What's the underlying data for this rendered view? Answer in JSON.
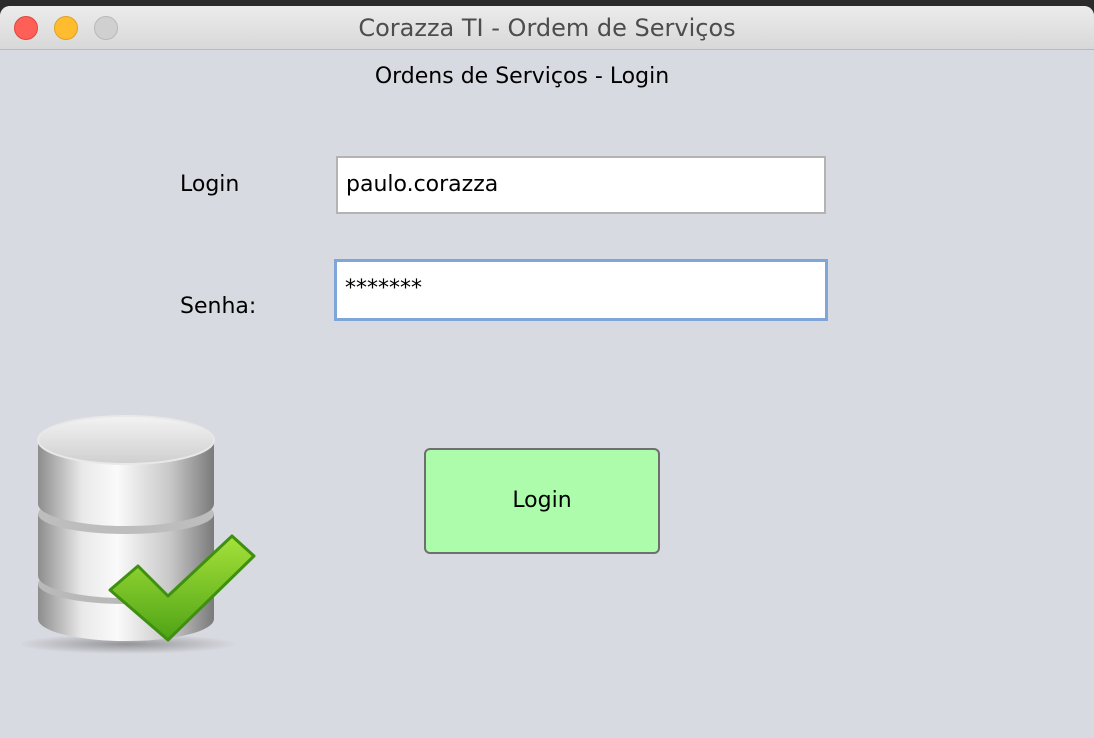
{
  "window": {
    "title": "Corazza TI - Ordem de Serviços"
  },
  "form": {
    "heading": "Ordens de Serviços - Login",
    "login_label": "Login",
    "login_value": "paulo.corazza",
    "password_label": "Senha:",
    "password_value": "*******",
    "submit_label": "Login"
  },
  "icons": {
    "close": "close-window-icon",
    "minimize": "minimize-window-icon",
    "zoom": "zoom-window-icon",
    "database": "database-check-icon"
  },
  "colors": {
    "window_bg": "#d8dae1",
    "button_bg": "#acfcac",
    "focus_border": "#7fa6d6",
    "close": "#fe5f57",
    "minimize": "#febc2e",
    "zoom_disabled": "#d0d0d0"
  }
}
